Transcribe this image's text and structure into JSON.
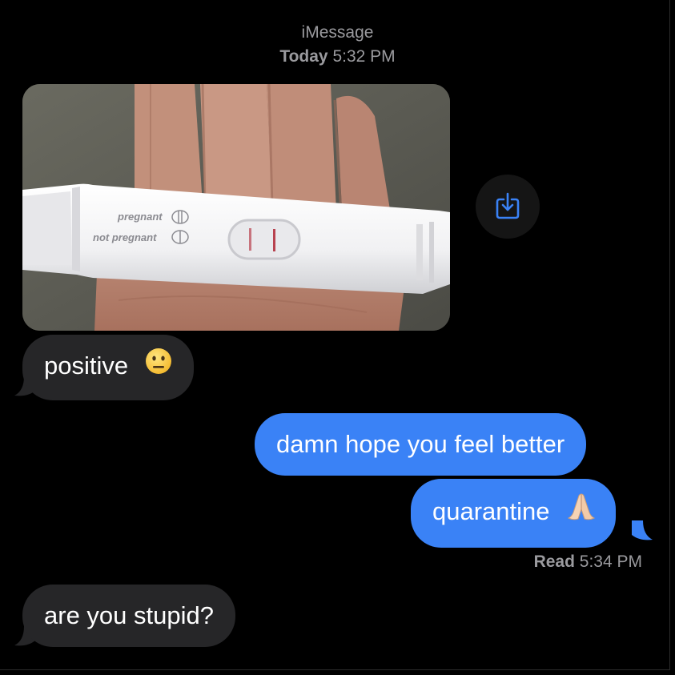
{
  "header": {
    "service": "iMessage",
    "day": "Today",
    "time": "5:32 PM"
  },
  "photo": {
    "test_labels": {
      "pregnant": "pregnant",
      "not_pregnant": "not pregnant"
    }
  },
  "messages": [
    {
      "side": "received",
      "text": "positive",
      "emoji": "neutral-face"
    },
    {
      "side": "sent",
      "text": "damn hope you feel better"
    },
    {
      "side": "sent",
      "text": "quarantine",
      "emoji": "folded-hands"
    },
    {
      "side": "received",
      "text": "are you stupid?"
    }
  ],
  "read_receipt": {
    "label": "Read",
    "time": "5:34 PM"
  },
  "colors": {
    "sent_bubble": "#3a82f6",
    "received_bubble": "#262628",
    "background": "#000000",
    "meta_text": "#9a9a9e"
  }
}
